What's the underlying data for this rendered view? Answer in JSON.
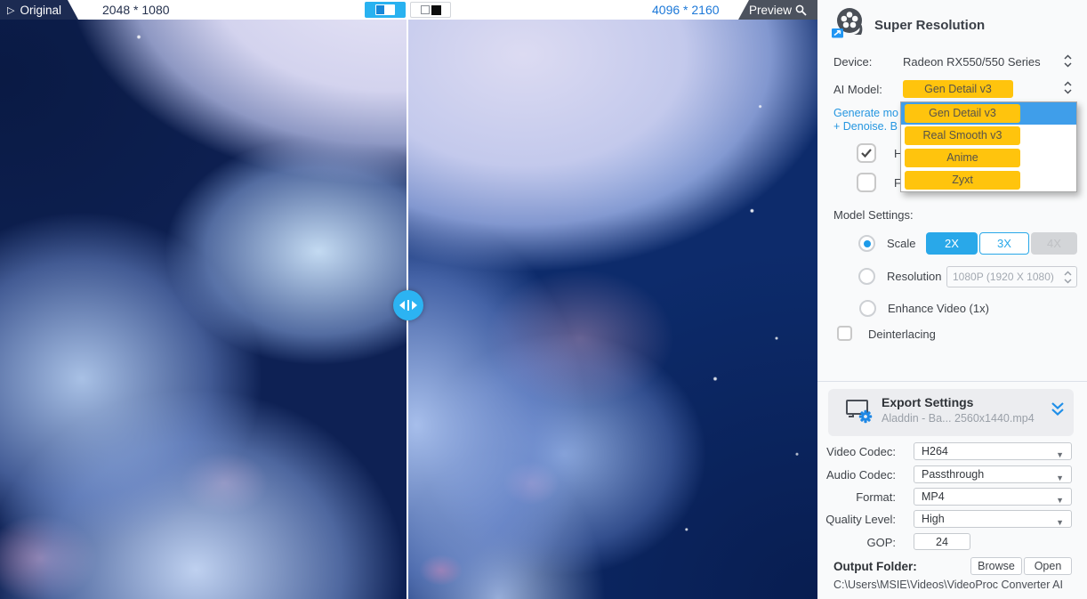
{
  "preview": {
    "original_tab_label": "Original",
    "original_resolution": "2048 * 1080",
    "output_resolution": "4096 * 2160",
    "preview_tab_label": "Preview"
  },
  "panel": {
    "title": "Super Resolution",
    "device_label": "Device:",
    "device_value": "Radeon RX550/550 Series",
    "ai_model_label": "AI Model:",
    "ai_model_value": "Gen Detail v3",
    "ai_model_options": [
      "Gen Detail v3",
      "Real Smooth v3",
      "Anime",
      "Zyxt"
    ],
    "description_line1": "Generate mo",
    "description_line2": "+ Denoise. B",
    "option_h_label": "H",
    "option_f_label": "F",
    "model_settings_label": "Model Settings:",
    "scale_label": "Scale",
    "scale_options": [
      "2X",
      "3X",
      "4X"
    ],
    "scale_selected": "2X",
    "resolution_label": "Resolution",
    "resolution_value": "1080P (1920 X 1080)",
    "enhance_label": "Enhance Video (1x)",
    "deinterlacing_label": "Deinterlacing"
  },
  "export": {
    "title": "Export Settings",
    "subtitle": "Aladdin - Ba... 2560x1440.mp4",
    "video_codec_label": "Video Codec:",
    "video_codec_value": "H264",
    "audio_codec_label": "Audio Codec:",
    "audio_codec_value": "Passthrough",
    "format_label": "Format:",
    "format_value": "MP4",
    "quality_label": "Quality Level:",
    "quality_value": "High",
    "gop_label": "GOP:",
    "gop_value": "24",
    "output_folder_label": "Output Folder:",
    "browse_label": "Browse",
    "open_label": "Open",
    "output_path": "C:\\Users\\MSIE\\Videos\\VideoProc Converter AI"
  },
  "colors": {
    "accent_blue": "#29a8e9",
    "model_pill_yellow": "#ffc40d",
    "highlight_row_blue": "#3f9eea",
    "link_blue": "#2596e0",
    "output_resolution_blue": "#1c78d8",
    "original_tab_navy": "#1c2b52",
    "preview_tab_slate": "#4c525e"
  }
}
